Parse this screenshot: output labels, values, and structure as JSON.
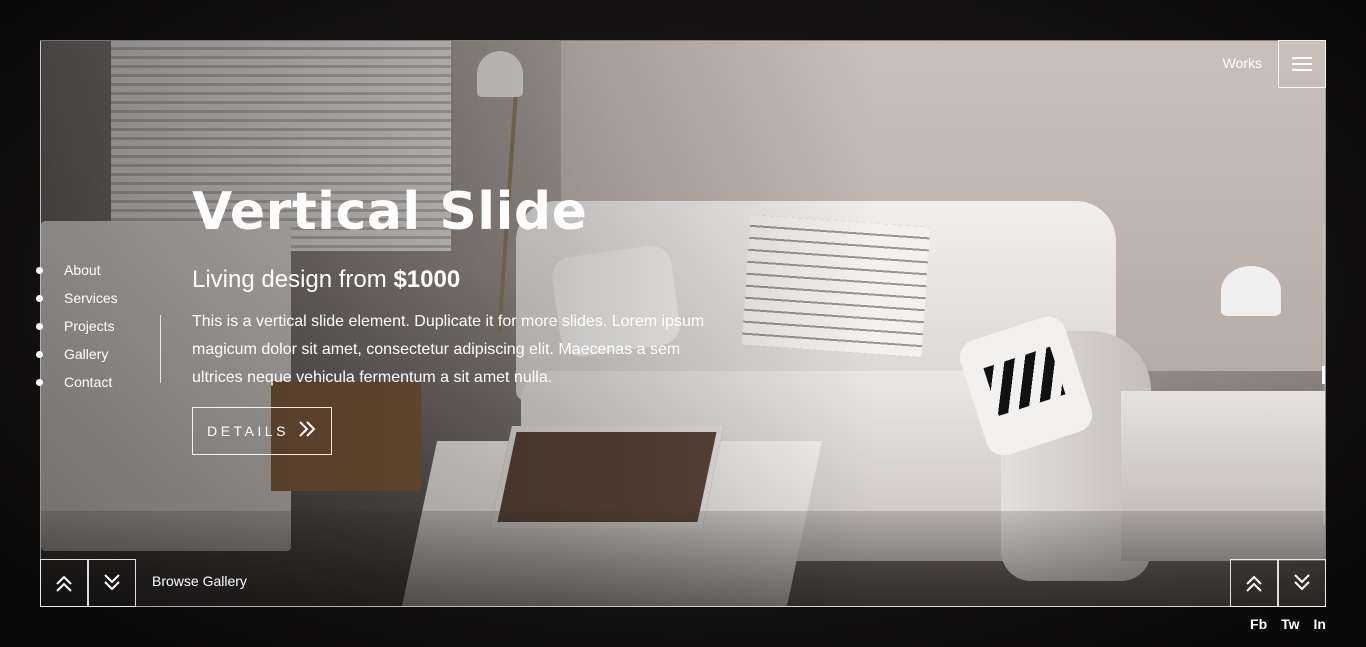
{
  "header": {
    "works_label": "Works",
    "menu_icon": "hamburger-icon"
  },
  "side_nav": {
    "items": [
      {
        "label": "About"
      },
      {
        "label": "Services"
      },
      {
        "label": "Projects"
      },
      {
        "label": "Gallery"
      },
      {
        "label": "Contact"
      }
    ]
  },
  "hero": {
    "title": "Vertical Slide",
    "subtitle_text": "Living design from ",
    "subtitle_price": "$1000",
    "description": "This is a vertical slide element. Duplicate it for more slides. Lorem ipsum magicum dolor sit amet, consectetur adipiscing elit. Maecenas a sem ultrices neque vehicula fermentum a sit amet nulla.",
    "details_label": "DETAILS"
  },
  "gallery_controls": {
    "browse_label": "Browse Gallery",
    "prev_icon": "double-chevron-up-icon",
    "next_icon": "double-chevron-down-icon"
  },
  "slide_controls": {
    "prev_icon": "double-chevron-up-icon",
    "next_icon": "double-chevron-down-icon"
  },
  "social": {
    "items": [
      {
        "label": "Fb"
      },
      {
        "label": "Tw"
      },
      {
        "label": "In"
      }
    ]
  },
  "colors": {
    "background": "#0d0c0c",
    "text": "#ffffff"
  }
}
